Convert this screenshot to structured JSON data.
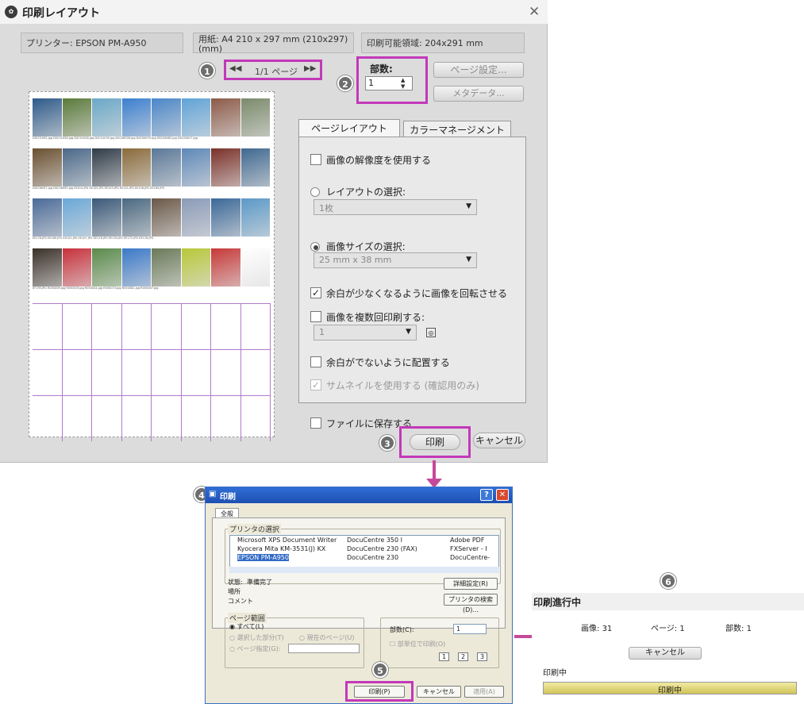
{
  "main_dialog": {
    "title": "印刷レイアウト",
    "printer_label": "プリンター:",
    "printer_value": "EPSON PM-A950",
    "paper_label": "用紙:",
    "paper_value": "A4 210 x 297 mm (210x297) (mm)",
    "printable_label": "印刷可能領域:",
    "printable_value": "204x291 mm",
    "page_indicator": "1/1 ページ",
    "copies_label": "部数:",
    "copies_value": "1",
    "page_setup_button": "ページ設定...",
    "metadata_button": "メタデータ...",
    "tabs": [
      "ページレイアウト",
      "カラーマネージメント"
    ],
    "options": {
      "use_resolution": "画像の解像度を使用する",
      "select_layout": "レイアウトの選択:",
      "layout_value": "1枚",
      "select_size": "画像サイズの選択:",
      "size_value": "25 mm x 38 mm",
      "rotate": "余白が少なくなるように画像を回転させる",
      "multi_print": "画像を複数回印刷する:",
      "multi_value": "1",
      "no_margin": "余白がでないように配置する",
      "use_thumbnail": "サムネイルを使用する (確認用のみ)"
    },
    "save_to_file": "ファイルに保存する",
    "print_button": "印刷",
    "cancel_button": "キャンセル",
    "icons": [
      "app-logo-icon",
      "close-icon",
      "first-page-icon",
      "last-page-icon",
      "spinner-icon",
      "dropdown-arrow-icon"
    ]
  },
  "steps": [
    "1",
    "2",
    "3",
    "4",
    "5",
    "6"
  ],
  "preview": {
    "rows": [
      {
        "caption": "DSC01092.jpg DSC01056.jpg DSC01028.jpg DSC01035.jpg DSC06026.jpg DSC06070.jpg DSC06082.jpg DSC06027.jpg"
      },
      {
        "caption": "DSC06057.jpg DSC06095.jpg EE014.JPG EE100.JPG EE103.JPG EE141.JPG EE156.JPG EE165.JPG"
      },
      {
        "caption": "EE176.JPG EE189.JPG EE102.JPG EE107.JPG EE116.JPG EE150.JPG EE172.JPG EE178.JPG"
      },
      {
        "caption": "EF195.JPG R050009.jpg R050019.jpg R050044.jpg R050073.jpg R050082.jpg R050087.jpg"
      }
    ],
    "thumb_colors": [
      [
        "#2e5a8a",
        "#5b7a3a",
        "#6aa8c8",
        "#3b7fd0",
        "#4a86c8",
        "#5fa3d8",
        "#8c5a48",
        "#7a8a6a"
      ],
      [
        "#6a5030",
        "#4a6888",
        "#2f3b48",
        "#8a6a3a",
        "#5a7898",
        "#5e88b8",
        "#7a3028",
        "#3e6890"
      ],
      [
        "#4a6a98",
        "#6aa8d8",
        "#3a5878",
        "#4a6880",
        "#6a5848",
        "#8a9ab8",
        "#3a6898",
        "#5a98c8"
      ],
      [
        "#3a3028",
        "#c8303a",
        "#5a8a4a",
        "#3a78c8",
        "#6a7a58",
        "#b8c838",
        "#c83838",
        "#ffffff"
      ]
    ]
  },
  "windows_print": {
    "title": "印刷",
    "tab": "全般",
    "printer_select": "プリンタの選択",
    "printers": [
      "Microsoft XPS Document Writer",
      "Kyocera Mita KM-3531(J) KX",
      "EPSON PM-A950",
      "DocuCentre 350 I",
      "DocuCentre 230 (FAX)",
      "DocuCentre 230",
      "Adobe PDF",
      "FXServer - I",
      "DocuCentre-"
    ],
    "status_label": "状態:",
    "status_value": "準備完了",
    "location_label": "場所",
    "comment_label": "コメント",
    "details_button": "詳細設定(R)",
    "find_printer_button": "プリンタの検索(D)...",
    "page_range": "ページ範囲",
    "range_all": "すべて(L)",
    "range_selection": "選択した部分(T)",
    "range_current": "現在のページ(U)",
    "range_pages": "ページ指定(G):",
    "copies_label": "部数(C):",
    "copies_value": "1",
    "collate": "部単位で印刷(O)",
    "print_button": "印刷(P)",
    "cancel_button": "キャンセル",
    "apply_button": "適用(A)",
    "collate_pages": [
      "1",
      "2",
      "3"
    ]
  },
  "progress": {
    "title": "印刷進行中",
    "images_label": "画像:",
    "images_value": "31",
    "page_label": "ページ:",
    "page_value": "1",
    "copies_label": "部数:",
    "copies_value": "1",
    "cancel_button": "キャンセル",
    "status_label": "印刷中",
    "bar_label": "印刷中",
    "bar_fraction": 1.0
  }
}
